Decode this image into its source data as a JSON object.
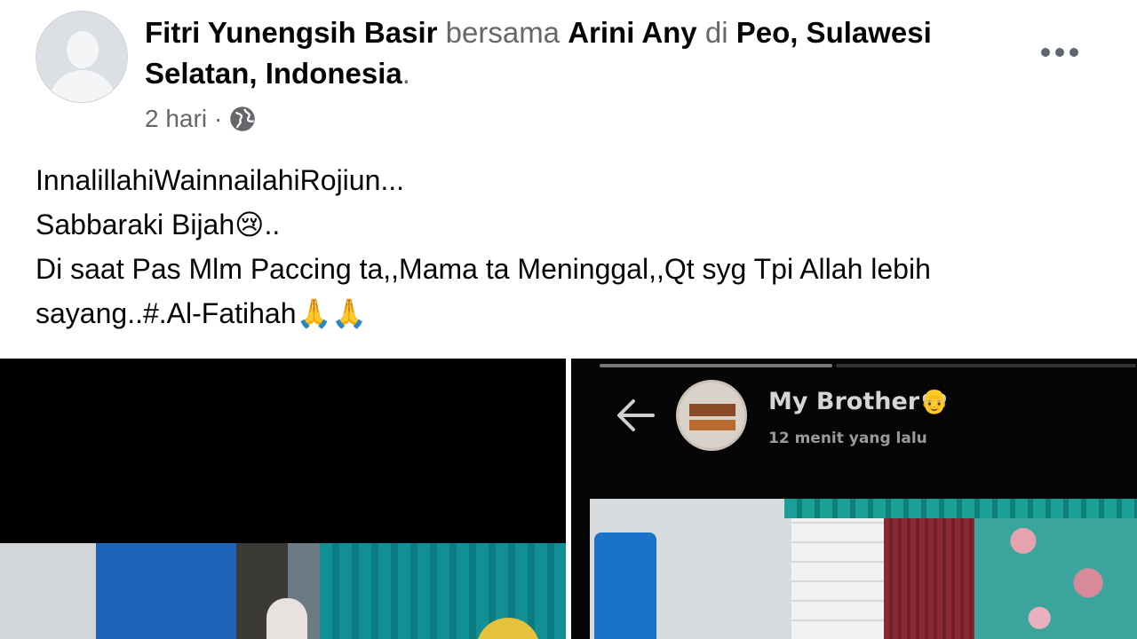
{
  "post": {
    "author": "Fitri Yunengsih Basir",
    "with_word": "bersama",
    "tagged": "Arini Any",
    "at_word": "di",
    "location": "Peo, Sulawesi Selatan, Indonesia",
    "period": ".",
    "time": "2 hari",
    "separator": "·",
    "privacy_icon": "globe-icon",
    "more_icon": "more-options-icon",
    "lines": [
      "InnalillahiWainnailahiRojiun...",
      "Sabbaraki Bijah😢..",
      "Di saat Pas Mlm Paccing ta,,Mama ta Meninggal,,Qt syg Tpi Allah lebih",
      "sayang..#.Al-Fatihah🙏🙏"
    ]
  },
  "photos": {
    "second": {
      "story_name": "My Brother👴",
      "story_time": "12 menit yang lalu",
      "back_icon": "back-arrow-icon"
    }
  },
  "colors": {
    "text": "#050505",
    "muted": "#65676b",
    "background": "#ffffff"
  }
}
